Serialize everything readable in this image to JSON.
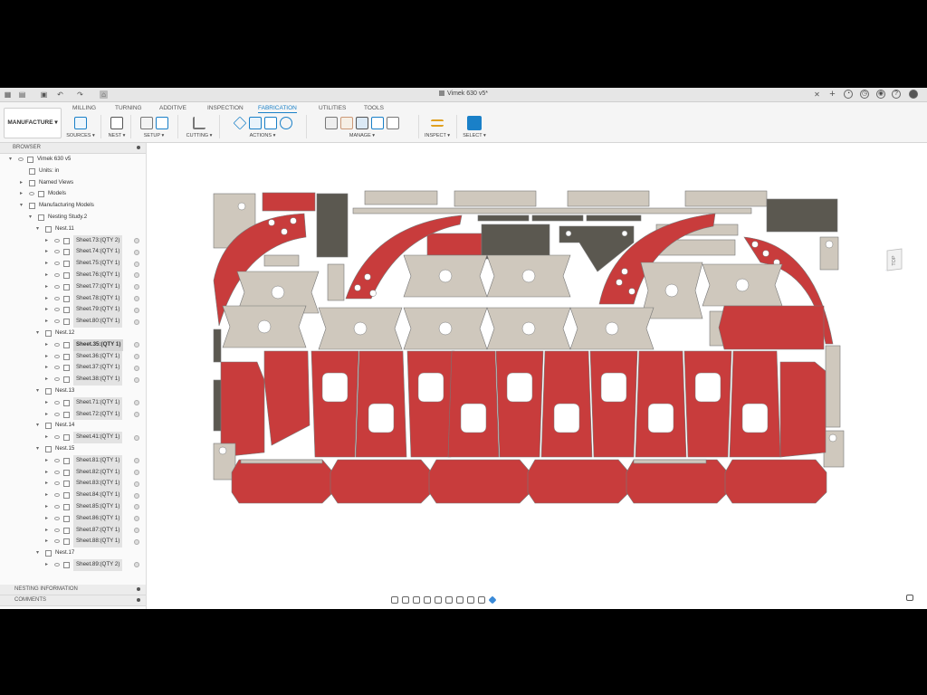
{
  "window": {
    "title": "Vimek 630 v5*"
  },
  "workspace": {
    "label": "MANUFACTURE ▾"
  },
  "tabs": [
    "MILLING",
    "TURNING",
    "ADDITIVE",
    "INSPECTION",
    "FABRICATION",
    "UTILITIES",
    "TOOLS"
  ],
  "active_tab": "FABRICATION",
  "groups": {
    "sources": "SOURCES ▾",
    "nest": "NEST ▾",
    "setup": "SETUP ▾",
    "cutting": "CUTTING ▾",
    "actions": "ACTIONS ▾",
    "manage": "MANAGE ▾",
    "inspect": "INSPECT ▾",
    "select": "SELECT ▾"
  },
  "browser": {
    "title": "BROWSER",
    "root": "Vimek 630 v5",
    "units": "Units: in",
    "named_views": "Named Views",
    "models": "Models",
    "manufacturing_models": "Manufacturing Models",
    "nesting_study": "Nesting Study.2",
    "nests": [
      {
        "name": "Nest.11",
        "sheets": [
          "Sheet.73:(QTY 2)",
          "Sheet.74:(QTY 1)",
          "Sheet.75:(QTY 1)",
          "Sheet.76:(QTY 1)",
          "Sheet.77:(QTY 1)",
          "Sheet.78:(QTY 1)",
          "Sheet.79:(QTY 1)",
          "Sheet.80:(QTY 1)"
        ]
      },
      {
        "name": "Nest.12",
        "sheets": [
          "Sheet.35:(QTY 1)",
          "Sheet.36:(QTY 1)",
          "Sheet.37:(QTY 1)",
          "Sheet.38:(QTY 1)"
        ]
      },
      {
        "name": "Nest.13",
        "sheets": [
          "Sheet.71:(QTY 1)",
          "Sheet.72:(QTY 1)"
        ]
      },
      {
        "name": "Nest.14",
        "sheets": [
          "Sheet.41:(QTY 1)"
        ]
      },
      {
        "name": "Nest.15",
        "sheets": [
          "Sheet.81:(QTY 1)",
          "Sheet.82:(QTY 1)",
          "Sheet.83:(QTY 1)",
          "Sheet.84:(QTY 1)",
          "Sheet.85:(QTY 1)",
          "Sheet.86:(QTY 1)",
          "Sheet.87:(QTY 1)",
          "Sheet.88:(QTY 1)"
        ]
      },
      {
        "name": "Nest.17",
        "sheets": [
          "Sheet.89:(QTY 2)"
        ]
      }
    ],
    "selected_sheet": "Sheet.35:(QTY 1)"
  },
  "panels": {
    "nesting_information": "NESTING INFORMATION",
    "comments": "COMMENTS"
  },
  "viewcube": {
    "face": "TOP"
  },
  "colors": {
    "red_part": "#c83c3c",
    "beige_part": "#cfc8bd",
    "dark_part": "#5b5850",
    "accent": "#1a80c8"
  }
}
